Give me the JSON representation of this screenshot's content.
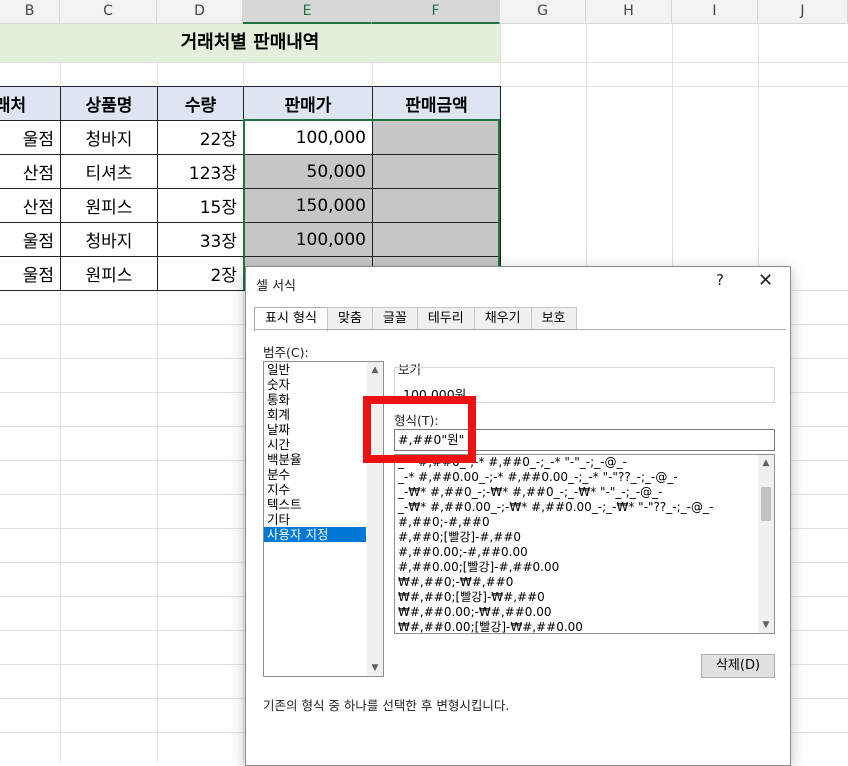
{
  "columns": [
    "B",
    "C",
    "D",
    "E",
    "F",
    "G",
    "H",
    "I",
    "J"
  ],
  "selected_columns": [
    "E",
    "F"
  ],
  "sheet_title": "거래처별 판매내역",
  "table": {
    "headers": [
      "래처",
      "상품명",
      "수량",
      "판매가",
      "판매금액"
    ],
    "rows": [
      [
        "울점",
        "청바지",
        "22장",
        "100,000",
        ""
      ],
      [
        "산점",
        "티셔츠",
        "123장",
        "50,000",
        ""
      ],
      [
        "산점",
        "원피스",
        "15장",
        "150,000",
        ""
      ],
      [
        "울점",
        "청바지",
        "33장",
        "100,000",
        ""
      ],
      [
        "울점",
        "원피스",
        "2장",
        "",
        ""
      ]
    ]
  },
  "dialog": {
    "title": "셀 서식",
    "help": "?",
    "close": "✕",
    "tabs": [
      "표시 형식",
      "맞춤",
      "글꼴",
      "테두리",
      "채우기",
      "보호"
    ],
    "active_tab": "표시 형식",
    "category_label": "범주(C):",
    "categories": [
      "일반",
      "숫자",
      "통화",
      "회계",
      "날짜",
      "시간",
      "백분율",
      "분수",
      "지수",
      "텍스트",
      "기타",
      "사용자 지정"
    ],
    "selected_category": "사용자 지정",
    "sample_label": "보기",
    "sample_value": "100,000원",
    "format_label": "형식(T):",
    "format_value": "#,##0\"원\"",
    "format_options": [
      "_-* #,##0_-;-* #,##0_-;_-* \"-\"_-;_-@_-",
      "_-* #,##0.00_-;-* #,##0.00_-;_-* \"-\"??_-;_-@_-",
      "_-₩* #,##0_-;-₩* #,##0_-;_-₩* \"-\"_-;_-@_-",
      "_-₩* #,##0.00_-;-₩* #,##0.00_-;_-₩* \"-\"??_-;_-@_-",
      "#,##0;-#,##0",
      "#,##0;[빨강]-#,##0",
      "#,##0.00;-#,##0.00",
      "#,##0.00;[빨강]-#,##0.00",
      "₩#,##0;-₩#,##0",
      "₩#,##0;[빨강]-₩#,##0",
      "₩#,##0.00;-₩#,##0.00",
      "₩#,##0.00;[빨강]-₩#,##0.00"
    ],
    "delete_button": "삭제(D)",
    "hint": "기존의 형식 중 하나를 선택한 후 변형시킵니다."
  },
  "colors": {
    "title_band": "#e2efda",
    "header_fill": "#dce6f2",
    "selection": "#217346",
    "highlight_box": "#ee1111"
  }
}
